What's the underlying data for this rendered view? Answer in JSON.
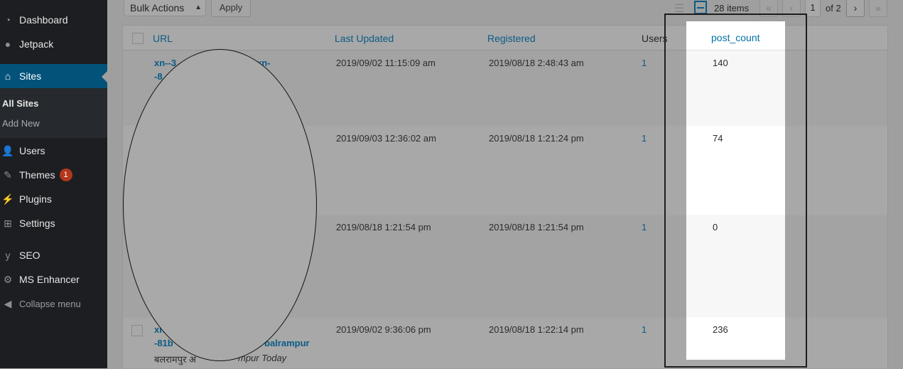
{
  "sidebar": {
    "items": [
      {
        "label": "Dashboard",
        "icon": "dashboard-icon"
      },
      {
        "label": "Jetpack",
        "icon": "jetpack-icon"
      },
      {
        "label": "Sites",
        "icon": "sites-icon",
        "active": true
      },
      {
        "label": "Users",
        "icon": "users-icon"
      },
      {
        "label": "Themes",
        "icon": "themes-icon",
        "badge": "1"
      },
      {
        "label": "Plugins",
        "icon": "plugins-icon"
      },
      {
        "label": "Settings",
        "icon": "settings-icon"
      },
      {
        "label": "SEO",
        "icon": "seo-icon"
      },
      {
        "label": "MS Enhancer",
        "icon": "gear-icon"
      },
      {
        "label": "Collapse menu",
        "icon": "collapse-icon"
      }
    ],
    "submenu": [
      {
        "label": "All Sites",
        "current": true
      },
      {
        "label": "Add New"
      }
    ]
  },
  "tablenav": {
    "bulk_actions": "Bulk Actions",
    "apply": "Apply",
    "items_count": "28 items",
    "first": "«",
    "prev": "‹",
    "current_page": "1",
    "of_pages": "of 2",
    "next": "›",
    "last": "»"
  },
  "table": {
    "columns": [
      "URL",
      "Last Updated",
      "Registered",
      "Users",
      "post_count"
    ],
    "rows": [
      {
        "url_line1": "xn--3",
        "url_line1b": "xn-",
        "url_line2": "-8",
        "last_updated": "2019/09/02 11:15:09 am",
        "registered": "2019/08/18 2:48:43 am",
        "users": "1",
        "post_count": "140"
      },
      {
        "last_updated": "2019/09/03 12:36:02 am",
        "registered": "2019/08/18 1:21:24 pm",
        "users": "1",
        "post_count": "74"
      },
      {
        "last_updated": "2019/08/18 1:21:54 pm",
        "registered": "2019/08/18 1:21:54 pm",
        "users": "1",
        "post_count": "0"
      },
      {
        "url_line1": "xn",
        "url_line2a": "-81b",
        "url_line2b": "balrampur",
        "desc_a": "बलरामपुर अ",
        "desc_b": "mpur Today",
        "last_updated": "2019/09/02 9:36:06 pm",
        "registered": "2019/08/18 1:22:14 pm",
        "users": "1",
        "post_count": "236"
      }
    ]
  },
  "colors": {
    "sidebar_bg": "#1c1e21",
    "active_bg": "#02527a",
    "link": "#0b5b86",
    "badge": "#b3371b"
  }
}
